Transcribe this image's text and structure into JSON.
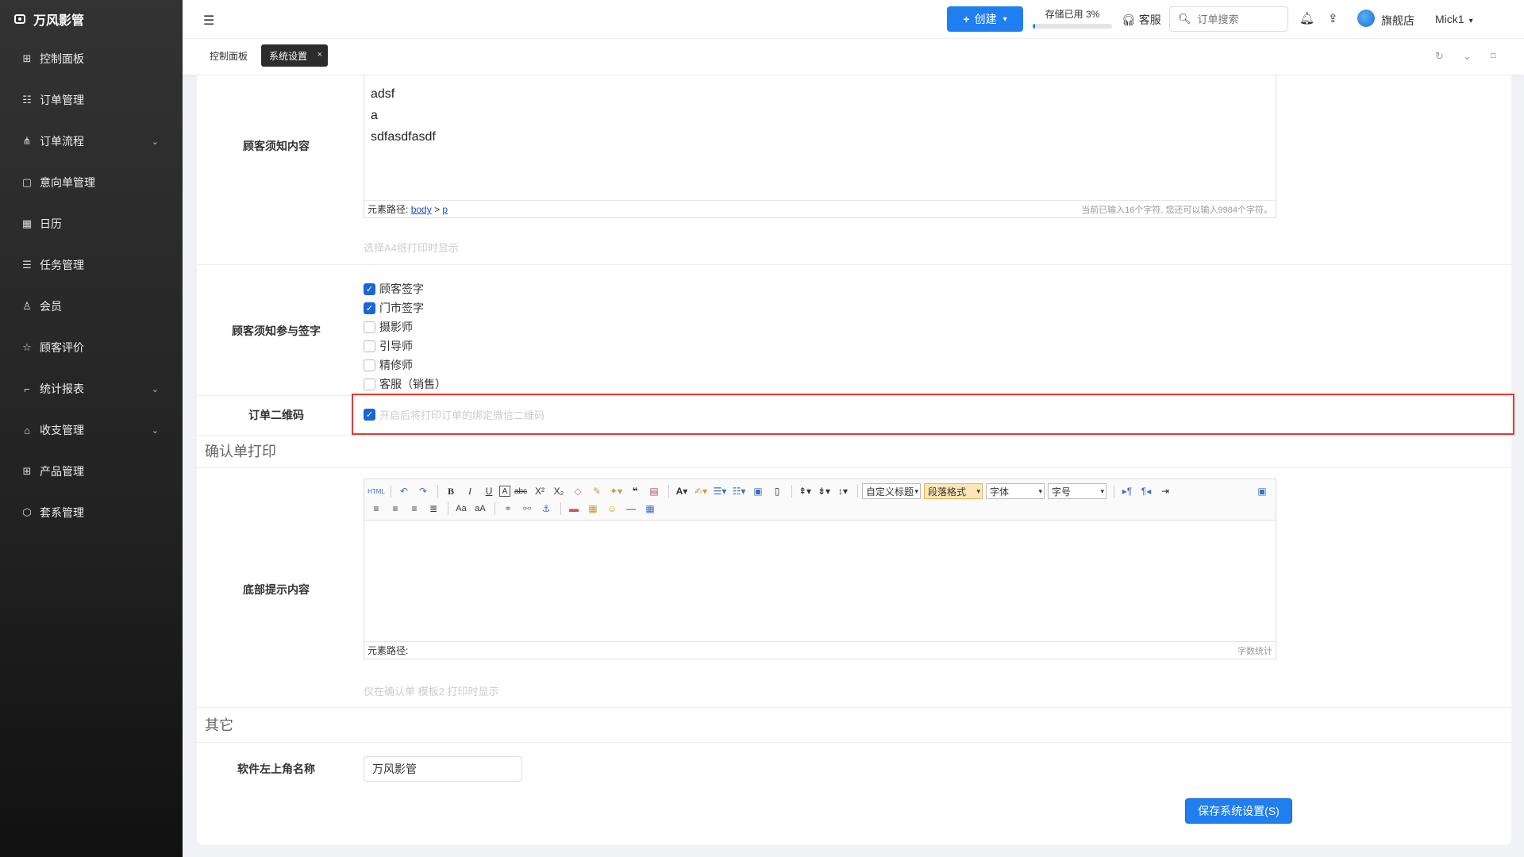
{
  "app": {
    "title": "万风影管"
  },
  "sidebar": {
    "items": [
      {
        "label": "控制面板",
        "icon": "grid-icon"
      },
      {
        "label": "订单管理",
        "icon": "list-icon"
      },
      {
        "label": "订单流程",
        "icon": "flow-icon",
        "expandable": true
      },
      {
        "label": "意向单管理",
        "icon": "note-icon"
      },
      {
        "label": "日历",
        "icon": "calendar-icon"
      },
      {
        "label": "任务管理",
        "icon": "task-icon"
      },
      {
        "label": "会员",
        "icon": "user-icon"
      },
      {
        "label": "顾客评价",
        "icon": "star-icon"
      },
      {
        "label": "统计报表",
        "icon": "chart-icon",
        "expandable": true
      },
      {
        "label": "收支管理",
        "icon": "bank-icon",
        "expandable": true
      },
      {
        "label": "产品管理",
        "icon": "product-icon"
      },
      {
        "label": "套系管理",
        "icon": "package-icon"
      }
    ]
  },
  "header": {
    "create_label": "创建",
    "storage_text": "存储已用 3%",
    "storage_percent": 3,
    "service_label": "客服",
    "search_placeholder": "订单搜索",
    "store_name": "旗舰店",
    "user_name": "Mick1"
  },
  "tabs": {
    "dashboard": "控制面板",
    "system": "系统设置"
  },
  "form": {
    "notice_label": "顾客须知内容",
    "notice_lines": [
      "adsf",
      "a",
      "sdfasdfasdf"
    ],
    "path_prefix": "元素路径:",
    "path_body": "body",
    "path_sep": ">",
    "path_p": "p",
    "notice_count": "当前已输入16个字符, 您还可以输入9984个字符。",
    "notice_hint": "选择A4纸打印时显示",
    "sign_label": "顾客须知参与签字",
    "sign_options": [
      {
        "label": "顾客签字",
        "checked": true
      },
      {
        "label": "门市签字",
        "checked": true
      },
      {
        "label": "摄影师",
        "checked": false
      },
      {
        "label": "引导师",
        "checked": false
      },
      {
        "label": "精修师",
        "checked": false
      },
      {
        "label": "客服（销售）",
        "checked": false
      }
    ],
    "qrcode_label": "订单二维码",
    "qrcode_text": "开启后将打印订单的绑定微信二维码",
    "confirm_section": "确认单打印",
    "footer_label": "底部提示内容",
    "footer_path": "元素路径:",
    "footer_count": "字数统计",
    "footer_hint": "仅在确认单 模板2 打印时显示",
    "other_section": "其它",
    "name_label": "软件左上角名称",
    "name_value": "万风影管",
    "save_label": "保存系统设置(S)"
  },
  "toolbar": {
    "custom_title": "自定义标题",
    "paragraph": "段落格式",
    "font": "字体",
    "size": "字号"
  },
  "colors": {
    "primary": "#1f7ef0",
    "highlight": "#e53935",
    "sidebar": "#2a2a2a"
  }
}
